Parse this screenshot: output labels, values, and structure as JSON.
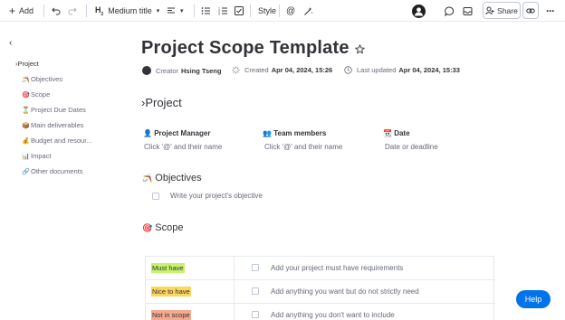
{
  "toolbar": {
    "add_label": "Add",
    "heading_style": "Medium title",
    "style_label": "Style",
    "share_label": "Share"
  },
  "sidebar": {
    "items": [
      {
        "icon": "›",
        "label": "Project"
      },
      {
        "icon": "🪃",
        "label": "Objectives"
      },
      {
        "icon": "🎯",
        "label": "Scope"
      },
      {
        "icon": "⏳",
        "label": "Project Due Dates"
      },
      {
        "icon": "📦",
        "label": "Main deliverables"
      },
      {
        "icon": "💰",
        "label": "Budget and resour..."
      },
      {
        "icon": "📊",
        "label": "Impact"
      },
      {
        "icon": "🔗",
        "label": "Other documents"
      }
    ]
  },
  "doc": {
    "title": "Project Scope Template",
    "creator_label": "Creator",
    "creator_name": "Hsing Tseng",
    "created_label": "Created",
    "created_date": "Apr 04, 2024, 15:26",
    "updated_label": "Last updated",
    "updated_date": "Apr 04, 2024, 15:33",
    "project_heading": "›Project",
    "fields": [
      {
        "icon": "👤",
        "label": "Project Manager",
        "placeholder": "Click '@' and their name"
      },
      {
        "icon": "👥",
        "label": "Team members",
        "placeholder": "Click '@' and their name"
      },
      {
        "icon": "📆",
        "label": "Date",
        "placeholder": "Date or deadline"
      }
    ],
    "objectives_heading": "Objectives",
    "objectives_icon": "🪃",
    "objective_placeholder": "Write your project's objective",
    "scope_heading": "Scope",
    "scope_icon": "🎯",
    "scope_rows": [
      {
        "tag": "Must have",
        "tag_color": "#c7f26e",
        "text": "Add your project must have requirements"
      },
      {
        "tag": "Nice to have",
        "tag_color": "#fdd65e",
        "text": "Add anything you want but do not strictly need"
      },
      {
        "tag": "Not in scope",
        "tag_color": "#f6a98e",
        "text": "Add anything you don't want to include"
      }
    ]
  },
  "help_label": "Help",
  "colors": {
    "accent": "#0073ea",
    "text": "#323338",
    "muted": "#676879",
    "border": "#e6e9ef"
  }
}
